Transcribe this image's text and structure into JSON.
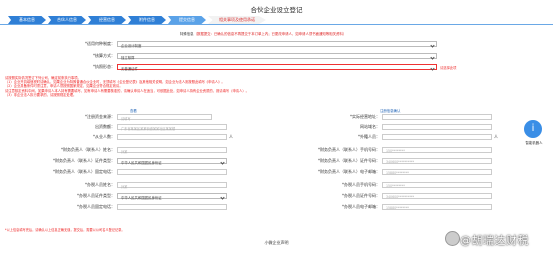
{
  "header": {
    "title": "合伙企业设立登记"
  },
  "steps": [
    {
      "label": "基本信息",
      "state": "done"
    },
    {
      "label": "合伙人信息",
      "state": "done"
    },
    {
      "label": "经营信息",
      "state": "done"
    },
    {
      "label": "附件信息",
      "state": "done"
    },
    {
      "label": "提交信息",
      "state": "active"
    },
    {
      "label": "相关事项及使用承诺",
      "state": "todo"
    }
  ],
  "notice": {
    "label": "特殊信息",
    "text": "（数据提交：已确认的信息不再提交于本订单上内；已更改申请人，如申请人须书面通知等相关资料）"
  },
  "form_top": {
    "rows": [
      {
        "label": "*适用何种制度：",
        "value": "企业设计制度",
        "error": ""
      },
      {
        "label": "*核算方式：",
        "value": "独立核算",
        "error": ""
      },
      {
        "label": "*执照形态：",
        "value": "无普通证件",
        "error": "请选择此项"
      }
    ]
  },
  "notes": [
    "请按照实际情况签订下列公司，确定前条执行事项。",
    "（1）企业开具增值税时请确认，如果企业为特殊普通合伙企业时，无须填写《企业登记表》及其他相关说明，如企业为法人则按照此填写《申请人》。",
    "（2）企业具备条件时须注意，申请人须按照国家规定，如果企业符合规定则请。",
    "请注意核定资料中间，如果申请人本人持有需要填写，如有申请人有需要核准的，请确认申请人在适当，可依据此处，如申请人持有企业资质的，则请填写（申请人）。",
    "（3）非企业法人执行要求的，请按照规定处理。"
  ],
  "form_contact": {
    "left": [
      {
        "label": "*注册资金来源：",
        "value": "请填写",
        "type": "input"
      },
      {
        "label": "出资数额：",
        "value": "广东省某某区某某街道某某社区某某楼",
        "type": "input"
      },
      {
        "label": "*从业人数：",
        "value": "",
        "type": "input",
        "suffix": "人"
      },
      {
        "label": "*财务负责人（联系人）姓名：",
        "value": "孙某",
        "type": "input"
      },
      {
        "label": "*财务负责人（联系人）证件类型：",
        "value": "中华人民共和国居民身份证",
        "type": "select"
      },
      {
        "label": "*财务负责人（联系人）固定电话：",
        "value": "",
        "type": "input"
      },
      {
        "label": "*办税人员姓名：",
        "value": "孙某",
        "type": "input"
      },
      {
        "label": "*办税人员证件类型：",
        "value": "中华人民共和国居民身份证",
        "type": "select"
      },
      {
        "label": "*办税人员固定电话：",
        "value": "",
        "type": "input"
      }
    ],
    "right": [
      {
        "label": "*实际经营地址：",
        "value": "",
        "type": "input"
      },
      {
        "label": "网站域名：",
        "value": "",
        "type": "input"
      },
      {
        "label": "*外籍人员：",
        "value": "",
        "type": "input",
        "suffix": "人"
      },
      {
        "label": "*财务负责人（联系人）手机号码：",
        "value": "150********",
        "type": "input"
      },
      {
        "label": "*财务负责人（联系人）证件号码：",
        "value": "340600**********",
        "type": "input"
      },
      {
        "label": "*财务负责人（联系人）电子邮箱：",
        "value": "15880********",
        "type": "input"
      },
      {
        "label": "*办税人员手机号码：",
        "value": "150********",
        "type": "input"
      },
      {
        "label": "*办税人员证件号码：",
        "value": "340600**********",
        "type": "input"
      },
      {
        "label": "*办税人员电子邮箱：",
        "value": "15880********",
        "type": "input"
      }
    ],
    "link_text": "查看",
    "link_text2": "注册信息确认"
  },
  "side": {
    "label": "智能机器人",
    "icon": "robot-icon",
    "glyph": "i"
  },
  "bottom_note": "*以上信息填写完后，请确认以上信息正确无误，提交后，需要以公司名义登记记录。",
  "footer": {
    "text": "小微企业声明"
  },
  "watermark": {
    "text": "@胡瑞达财税"
  },
  "colors": {
    "step_done": "#2f7fd6",
    "step_active": "#5aa2e8",
    "error": "#e33333",
    "link": "#1a5fb4"
  }
}
